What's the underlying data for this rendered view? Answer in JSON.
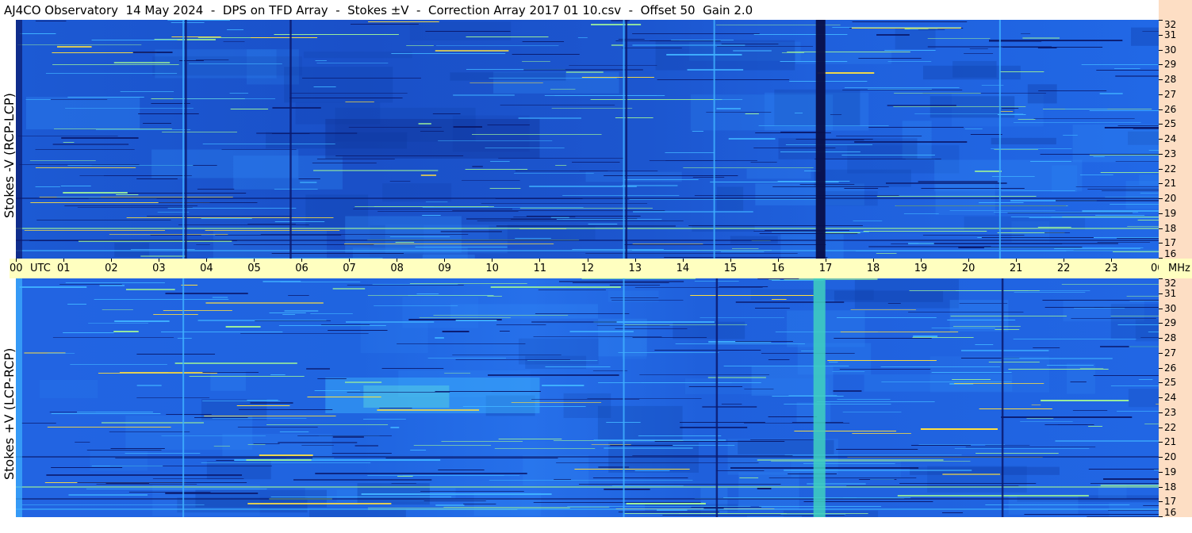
{
  "title": "AJ4CO Observatory  14 May 2024  -  DPS on TFD Array  -  Stokes ±V  -  Correction Array 2017 01 10.csv  -  Offset 50  Gain 2.0",
  "chart_data": [
    {
      "type": "heatmap",
      "name": "Stokes -V",
      "ylabel": "Stokes -V (RCP-LCP)",
      "x_label": "UTC",
      "x_ticks": [
        "00",
        "01",
        "02",
        "03",
        "04",
        "05",
        "06",
        "07",
        "08",
        "09",
        "10",
        "11",
        "12",
        "13",
        "14",
        "15",
        "16",
        "17",
        "18",
        "19",
        "20",
        "21",
        "22",
        "23",
        "00"
      ],
      "x_range_hours": [
        0,
        24
      ],
      "y_unit": "MHz",
      "y_ticks": [
        16,
        17,
        18,
        19,
        20,
        21,
        22,
        23,
        24,
        25,
        26,
        27,
        28,
        29,
        30,
        31,
        32
      ],
      "y_range_mhz": [
        16,
        32
      ],
      "colormap": [
        "#0a1a6e",
        "#1e5ad8",
        "#2a78f0",
        "#3fb0ff",
        "#9cf09a",
        "#ffe040"
      ],
      "features": {
        "dark_vertical_band_hours": [
          16.8,
          17.0
        ],
        "dark_vertical_lines_hours": [
          3.55,
          5.75,
          12.8
        ],
        "bright_vertical_lines_hours": [
          3.5,
          12.75,
          14.65,
          20.65
        ]
      }
    },
    {
      "type": "heatmap",
      "name": "Stokes +V",
      "ylabel": "Stokes +V  (LCP-RCP)",
      "x_label": "UTC",
      "x_ticks": [
        "00",
        "01",
        "02",
        "03",
        "04",
        "05",
        "06",
        "07",
        "08",
        "09",
        "10",
        "11",
        "12",
        "13",
        "14",
        "15",
        "16",
        "17",
        "18",
        "19",
        "20",
        "21",
        "22",
        "23",
        "00"
      ],
      "x_range_hours": [
        0,
        24
      ],
      "y_unit": "MHz",
      "y_ticks": [
        16,
        17,
        18,
        19,
        20,
        21,
        22,
        23,
        24,
        25,
        26,
        27,
        28,
        29,
        30,
        31,
        32
      ],
      "y_range_mhz": [
        16,
        32
      ],
      "colormap": [
        "#0a1a6e",
        "#1e5ad8",
        "#2a78f0",
        "#3fb0ff",
        "#9cf09a",
        "#ffe040"
      ],
      "features": {
        "bright_vertical_band_hours": [
          16.75,
          17.0
        ],
        "dark_vertical_lines_hours": [
          14.7,
          20.7
        ],
        "bright_vertical_lines_hours": [
          3.5,
          12.75
        ]
      }
    }
  ],
  "time_axis": {
    "utc_label": "UTC",
    "mhz_label": "MHz"
  }
}
